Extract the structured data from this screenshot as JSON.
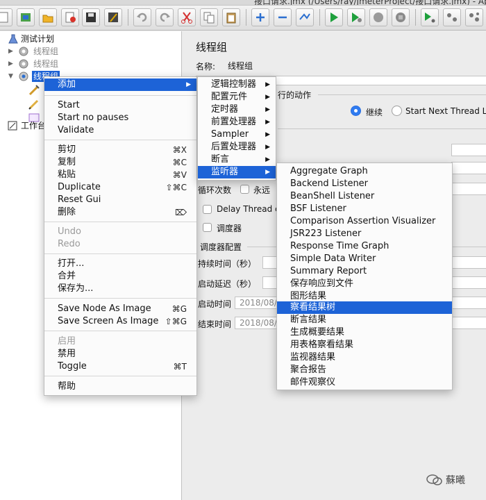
{
  "window": {
    "title": "接口请求.jmx (/Users/ray/JmeterProject/接口请求.jmx) - Ap"
  },
  "tree": {
    "items": [
      {
        "label": "测试计划"
      },
      {
        "label": "线程组"
      },
      {
        "label": "线程组"
      },
      {
        "label": "线程组"
      },
      {
        "label": "工作台"
      }
    ]
  },
  "panel": {
    "title": "线程组",
    "name_label": "名称:",
    "name_value": "线程组",
    "action_label": "行的动作",
    "continue_label": "继续",
    "start_next_label": "Start Next Thread Lo",
    "loop_label": "循环次数",
    "forever_label": "永远",
    "delay_label": "Delay Thread c",
    "scheduler_label": "调度器",
    "scheduler_config": "调度器配置",
    "duration_label": "持续时间（秒）",
    "startup_delay_label": "启动延迟（秒）",
    "start_time_label": "启动时间",
    "start_time_value": "2018/08/",
    "end_time_label": "结束时间",
    "end_time_value": "2018/08/"
  },
  "context_menu": {
    "add": "添加",
    "start": "Start",
    "start_no_pauses": "Start no pauses",
    "validate": "Validate",
    "cut": "剪切",
    "cut_key": "⌘X",
    "copy": "复制",
    "copy_key": "⌘C",
    "paste": "粘贴",
    "paste_key": "⌘V",
    "duplicate": "Duplicate",
    "duplicate_key": "⇧⌘C",
    "reset_gui": "Reset Gui",
    "delete": "删除",
    "delete_key": "⌦",
    "undo": "Undo",
    "redo": "Redo",
    "open": "打开...",
    "merge": "合并",
    "save_as": "保存为...",
    "save_node_image": "Save Node As Image",
    "save_node_image_key": "⌘G",
    "save_screen_image": "Save Screen As Image",
    "save_screen_image_key": "⇧⌘G",
    "enable": "启用",
    "disable": "禁用",
    "toggle": "Toggle",
    "toggle_key": "⌘T",
    "help": "帮助"
  },
  "add_submenu": {
    "items": [
      "逻辑控制器",
      "配置元件",
      "定时器",
      "前置处理器",
      "Sampler",
      "后置处理器",
      "断言",
      "监听器"
    ]
  },
  "listener_submenu": {
    "items": [
      "Aggregate Graph",
      "Backend Listener",
      "BeanShell Listener",
      "BSF Listener",
      "Comparison Assertion Visualizer",
      "JSR223 Listener",
      "Response Time Graph",
      "Simple Data Writer",
      "Summary Report",
      "保存响应到文件",
      "图形结果",
      "察看结果树",
      "断言结果",
      "生成概要结果",
      "用表格察看结果",
      "监视器结果",
      "聚合报告",
      "邮件观察仪"
    ]
  },
  "watermark": {
    "text": "蘇曦"
  },
  "colors": {
    "highlight": "#1d63d7",
    "menu_bg": "#fbfbfb"
  }
}
